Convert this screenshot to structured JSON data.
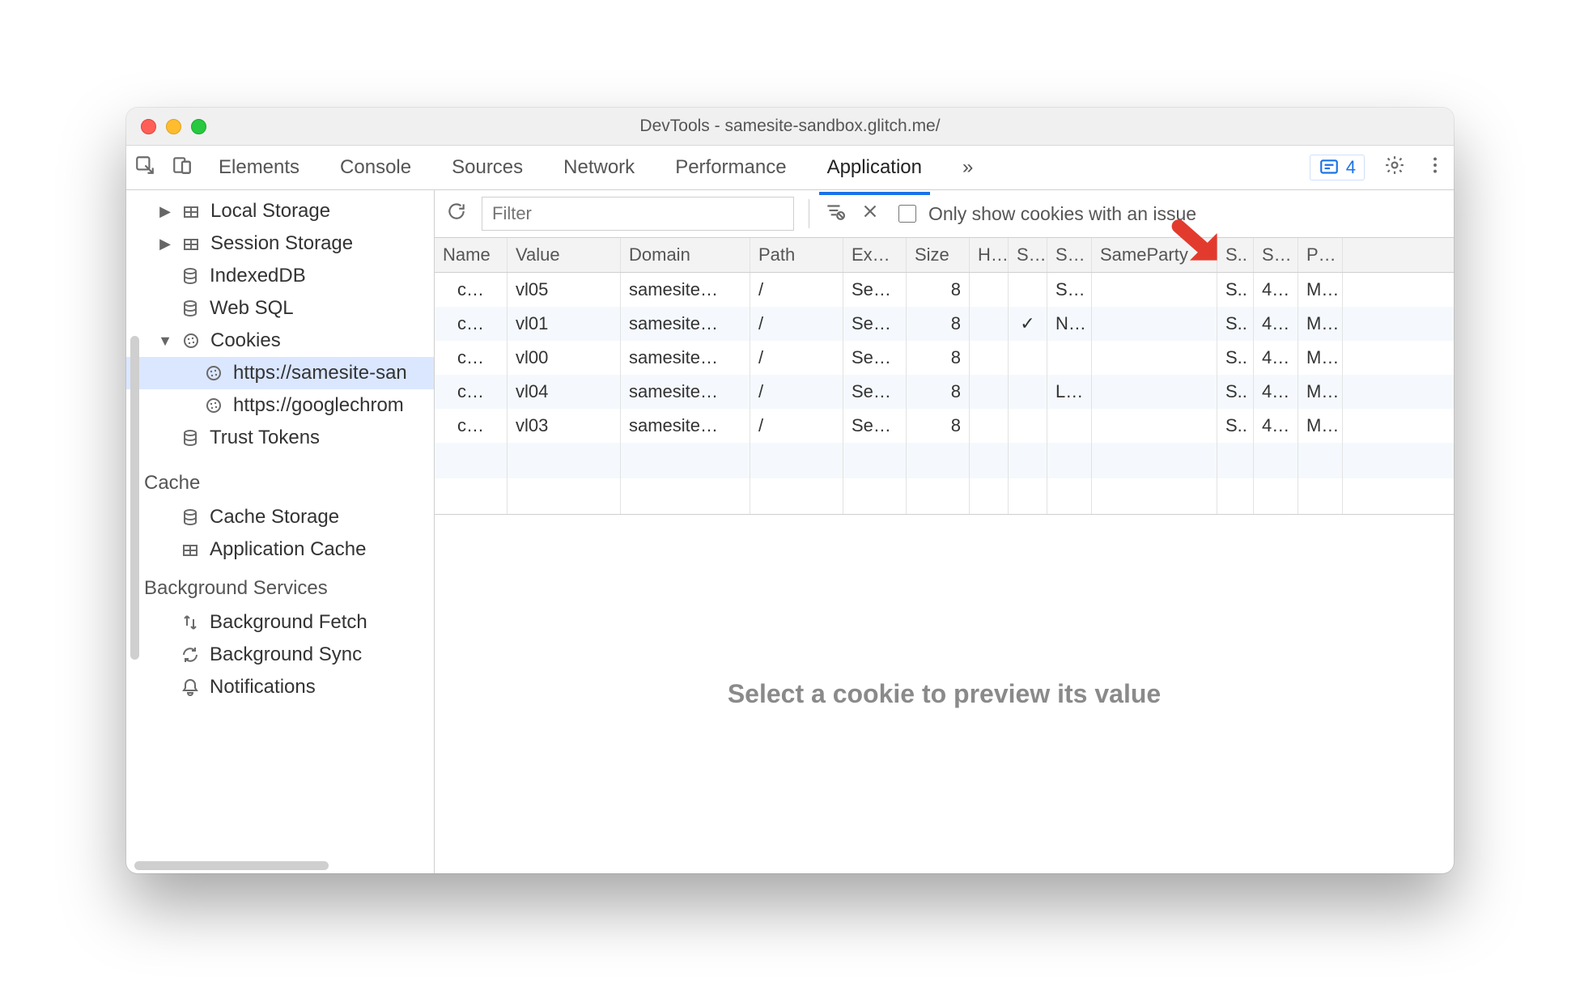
{
  "window_title": "DevTools - samesite-sandbox.glitch.me/",
  "tabs": {
    "items": [
      "Elements",
      "Console",
      "Sources",
      "Network",
      "Performance",
      "Application"
    ],
    "overflow_glyph": "»",
    "active_index": 5
  },
  "issues_count": "4",
  "sidebar": {
    "storage": {
      "local": "Local Storage",
      "session": "Session Storage",
      "indexeddb": "IndexedDB",
      "websql": "Web SQL",
      "cookies": "Cookies",
      "cookies_children": [
        "https://samesite-san",
        "https://googlechrom"
      ],
      "trust_tokens": "Trust Tokens"
    },
    "cache": {
      "title": "Cache",
      "cache_storage": "Cache Storage",
      "app_cache": "Application Cache"
    },
    "bg": {
      "title": "Background Services",
      "fetch": "Background Fetch",
      "sync": "Background Sync",
      "notifications": "Notifications"
    }
  },
  "toolbar": {
    "filter_placeholder": "Filter",
    "only_issues_label": "Only show cookies with an issue"
  },
  "columns": [
    "Name",
    "Value",
    "Domain",
    "Path",
    "Ex…",
    "Size",
    "H…",
    "S…",
    "S…",
    "SameParty",
    "S..",
    "S…",
    "P…"
  ],
  "rows": [
    {
      "name": "c…",
      "value": "vl05",
      "domain": "samesite…",
      "path": "/",
      "expires": "Se…",
      "size": "8",
      "http": "",
      "secure": "",
      "samesite": "S…",
      "sameparty": "",
      "s1": "S..",
      "s2": "4…",
      "p": "M…"
    },
    {
      "name": "c…",
      "value": "vl01",
      "domain": "samesite…",
      "path": "/",
      "expires": "Se…",
      "size": "8",
      "http": "",
      "secure": "✓",
      "samesite": "N…",
      "sameparty": "",
      "s1": "S..",
      "s2": "4…",
      "p": "M…"
    },
    {
      "name": "c…",
      "value": "vl00",
      "domain": "samesite…",
      "path": "/",
      "expires": "Se…",
      "size": "8",
      "http": "",
      "secure": "",
      "samesite": "",
      "sameparty": "",
      "s1": "S..",
      "s2": "4…",
      "p": "M…"
    },
    {
      "name": "c…",
      "value": "vl04",
      "domain": "samesite…",
      "path": "/",
      "expires": "Se…",
      "size": "8",
      "http": "",
      "secure": "",
      "samesite": "L…",
      "sameparty": "",
      "s1": "S..",
      "s2": "4…",
      "p": "M…"
    },
    {
      "name": "c…",
      "value": "vl03",
      "domain": "samesite…",
      "path": "/",
      "expires": "Se…",
      "size": "8",
      "http": "",
      "secure": "",
      "samesite": "",
      "sameparty": "",
      "s1": "S..",
      "s2": "4…",
      "p": "M…"
    }
  ],
  "preview_empty": "Select a cookie to preview its value"
}
